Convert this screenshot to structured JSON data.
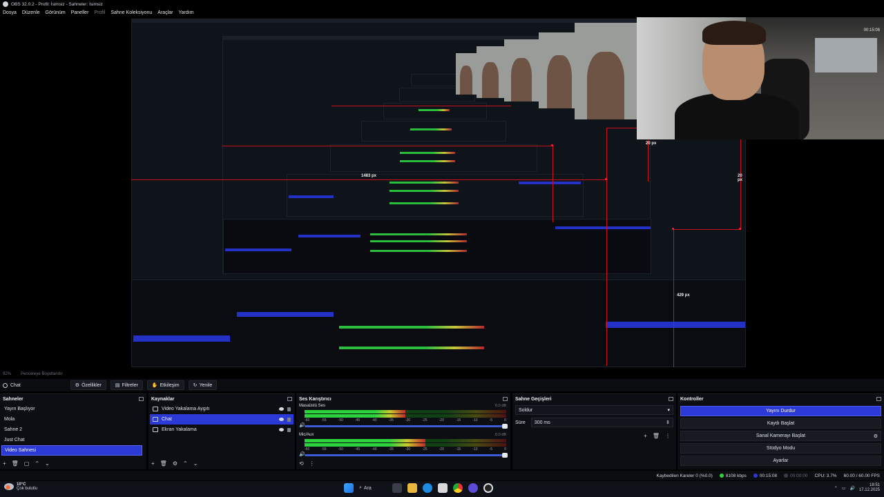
{
  "window": {
    "title": "OBS 32.0.2 - Profil: İsimsiz - Sahneler: İsimsiz"
  },
  "menu": [
    "Dosya",
    "Düzenle",
    "Görünüm",
    "Paneller",
    "Profil",
    "Sahne Koleksiyonu",
    "Araçlar",
    "Yardım"
  ],
  "preview": {
    "measure_labels": [
      "1483 px",
      "429 px",
      "20 px",
      "20 px"
    ],
    "status": {
      "zoom": "92%",
      "scale_mode": "Pencereye Boyutlandır"
    },
    "cam_clock": "00:15:08"
  },
  "scene_bar": {
    "current": "Chat",
    "buttons": {
      "properties": "Özellikler",
      "filters": "Filtreler",
      "interact": "Etkileşim",
      "refresh": "Yenile"
    }
  },
  "scenes": {
    "title": "Sahneler",
    "items": [
      "Yayın Başlıyor",
      "Mola",
      "Sahne 2",
      "Just Chat",
      "Video Sahnesi"
    ],
    "selected_index": 4
  },
  "sources": {
    "title": "Kaynaklar",
    "items": [
      "Video Yakalama Aygıtı",
      "Chat",
      "Ekran Yakalama"
    ],
    "selected_index": 1
  },
  "mixer": {
    "title": "Ses Karıştırıcı",
    "channels": [
      {
        "name": "Masaüstü Ses",
        "db": "0.0 dB",
        "level": 0.5
      },
      {
        "name": "Mic/Aux",
        "db": "0.0 dB",
        "level": 0.6
      }
    ],
    "ticks": [
      "-60",
      "-55",
      "-50",
      "-45",
      "-40",
      "-35",
      "-30",
      "-25",
      "-20",
      "-15",
      "-10",
      "-5",
      "0"
    ]
  },
  "transitions": {
    "title": "Sahne Geçişleri",
    "type": "Soldur",
    "duration_label": "Süre",
    "duration": "300 ms"
  },
  "controls": {
    "title": "Kontroller",
    "buttons": [
      "Yayını Durdur",
      "Kaydı Başlat",
      "Sanal Kamerayı Başlat",
      "Stüdyo Modu",
      "Ayarlar"
    ],
    "active_index": 0
  },
  "stats": {
    "dropped": "Kaybedilen Kareler 0 (%0.0)",
    "bitrate": "8108 kbps",
    "stream_time": "00:15:08",
    "rec_time": "00:00:00",
    "cpu": "CPU: 3.7%",
    "fps": "60.00 / 60.00 FPS"
  },
  "taskbar": {
    "weather_temp": "10°C",
    "weather_desc": "Çok bulutlu",
    "search": "Ara",
    "time": "18:51",
    "date": "17.12.2025"
  },
  "colors": {
    "accent": "#2b39d6",
    "measure": "#d0101c",
    "meter_green": "#2bd33c"
  }
}
